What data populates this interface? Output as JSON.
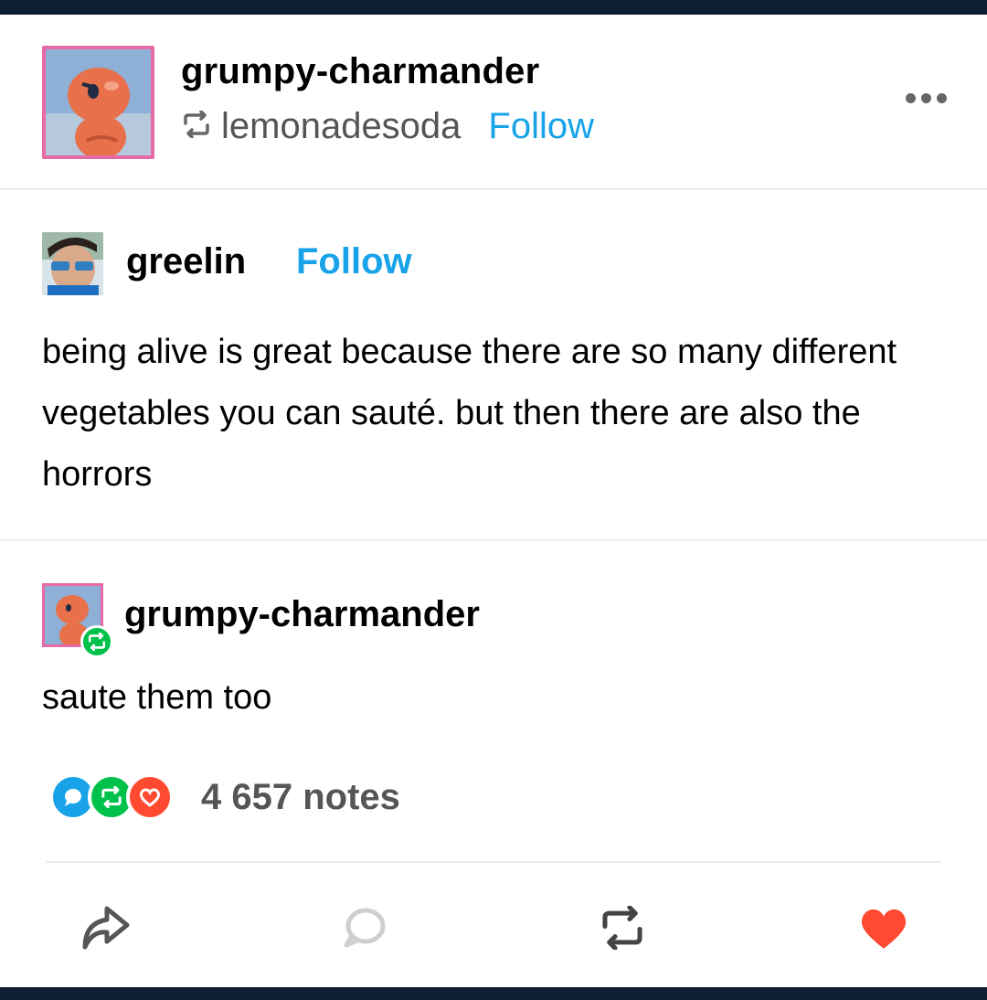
{
  "header": {
    "blog_name": "grumpy-charmander",
    "reblogged_from": "lemonadesoda",
    "follow_label": "Follow",
    "more_icon": "more-horizontal-icon"
  },
  "original_post": {
    "author": "greelin",
    "follow_label": "Follow",
    "body": "being alive is great because there are so many different vegetables you can sauté.  but then there are also the horrors"
  },
  "reblog": {
    "author": "grumpy-charmander",
    "body": "saute them too"
  },
  "notes": {
    "count_label": "4 657 notes",
    "icons": [
      "comment-icon",
      "reblog-icon",
      "like-icon"
    ]
  },
  "actions": {
    "icons": [
      "share-icon",
      "reply-icon",
      "reblog-icon",
      "like-icon"
    ]
  },
  "colors": {
    "accent_blue": "#18a3e8",
    "reblog_green": "#00c24a",
    "like_red": "#ff4930",
    "bar_navy": "#0f1f33",
    "avatar_border_pink": "#e76aa6"
  }
}
